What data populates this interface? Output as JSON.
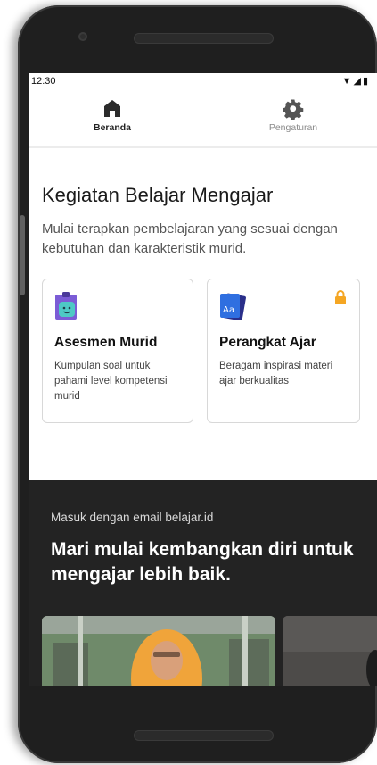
{
  "status_bar": {
    "time": "12:30",
    "icons": "▼◢▮"
  },
  "nav_tabs": [
    {
      "label": "Beranda",
      "icon": "home-icon",
      "active": true
    },
    {
      "label": "Pengaturan",
      "icon": "gear-icon",
      "active": false
    }
  ],
  "main": {
    "title": "Kegiatan Belajar Mengajar",
    "description": "Mulai terapkan pembelajaran yang sesuai dengan kebutuhan dan karakteristik murid.",
    "cards": [
      {
        "title": "Asesmen Murid",
        "description": "Kumpulan soal untuk pahami level kompetensi murid",
        "icon": "clipboard-smile-icon",
        "locked": false
      },
      {
        "title": "Perangkat Ajar",
        "description": "Beragam inspirasi materi ajar berkualitas",
        "icon": "book-aa-icon",
        "icon_text": "Aa",
        "locked": true
      }
    ]
  },
  "promo": {
    "login_hint": "Masuk dengan email belajar.id",
    "headline": "Mari mulai kembangkan diri untuk mengajar lebih baik."
  },
  "colors": {
    "accent_orange": "#f5a623",
    "dark_bg": "#232323",
    "icon_blue": "#2f6fe0",
    "icon_teal": "#4ec9c5"
  }
}
